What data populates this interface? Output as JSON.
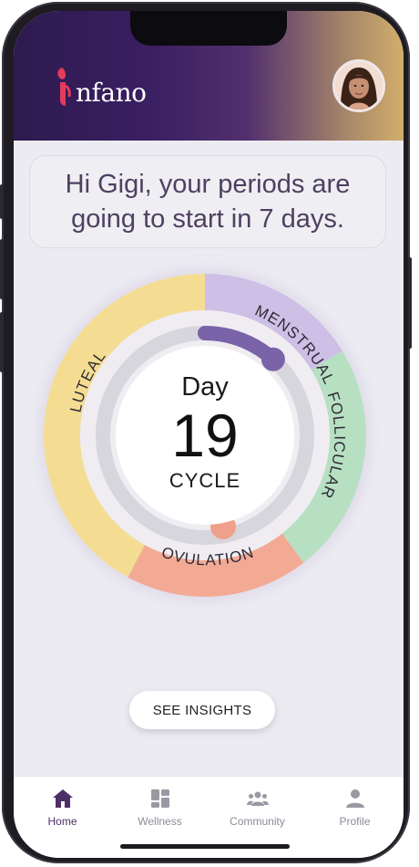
{
  "app": {
    "logo_text": "nfano"
  },
  "header": {
    "avatar": "user-avatar"
  },
  "greeting": {
    "text": "Hi Gigi, your periods are going to start in 7 days."
  },
  "cycle": {
    "day_label": "Day",
    "day_number": "19",
    "cycle_label": "CYCLE",
    "phases": {
      "menstrual": "MENSTRUAL",
      "follicular": "FOLLICULAR",
      "ovulation": "OVULATION",
      "luteal": "LUTEAL"
    },
    "colors": {
      "menstrual": "#cdbfe6",
      "follicular": "#b7e0c3",
      "ovulation": "#f3aa94",
      "luteal": "#f4dd92",
      "progress": "#7a63a8",
      "ovulation_marker": "#f0a08a"
    }
  },
  "actions": {
    "see_insights": "SEE INSIGHTS"
  },
  "nav": {
    "items": [
      {
        "label": "Home",
        "icon": "home-icon",
        "active": true
      },
      {
        "label": "Wellness",
        "icon": "grid-icon",
        "active": false
      },
      {
        "label": "Community",
        "icon": "community-icon",
        "active": false
      },
      {
        "label": "Profile",
        "icon": "profile-icon",
        "active": false
      }
    ]
  }
}
